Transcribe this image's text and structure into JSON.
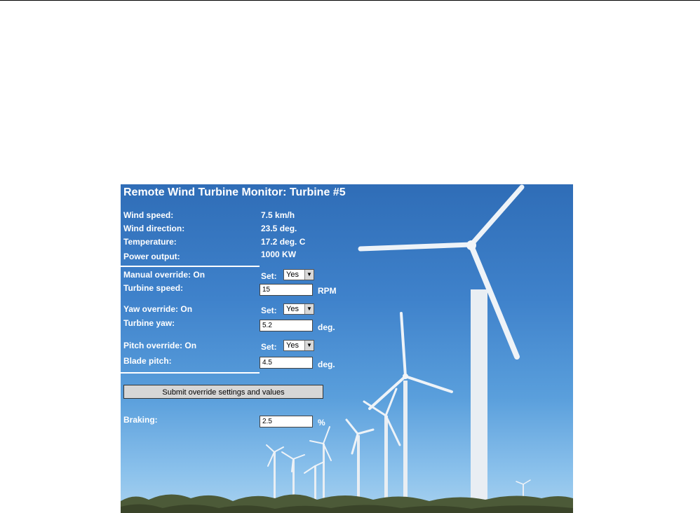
{
  "title": "Remote Wind Turbine Monitor: Turbine #5",
  "readings": [
    {
      "label": "Wind speed:",
      "value": "7.5 km/h"
    },
    {
      "label": "Wind direction:",
      "value": "23.5 deg."
    },
    {
      "label": "Temperature:",
      "value": "17.2 deg. C"
    },
    {
      "label": "Power output:",
      "value": "1000 KW"
    }
  ],
  "overrides": {
    "manual": {
      "status": "Manual override: On",
      "set_label": "Set:",
      "set_value": "Yes",
      "field_label": "Turbine speed:",
      "field_value": "15",
      "unit": "RPM"
    },
    "yaw": {
      "status": "Yaw override: On",
      "set_label": "Set:",
      "set_value": "Yes",
      "field_label": "Turbine yaw:",
      "field_value": "5.2",
      "unit": "deg."
    },
    "pitch": {
      "status": "Pitch override: On",
      "set_label": "Set:",
      "set_value": "Yes",
      "field_label": "Blade pitch:",
      "field_value": "4.5",
      "unit": "deg."
    }
  },
  "submit_label": "Submit override settings and values",
  "braking": {
    "label": "Braking:",
    "value": "2.5",
    "unit": "%"
  },
  "icons": {
    "dropdown": "chevron-down-icon"
  }
}
